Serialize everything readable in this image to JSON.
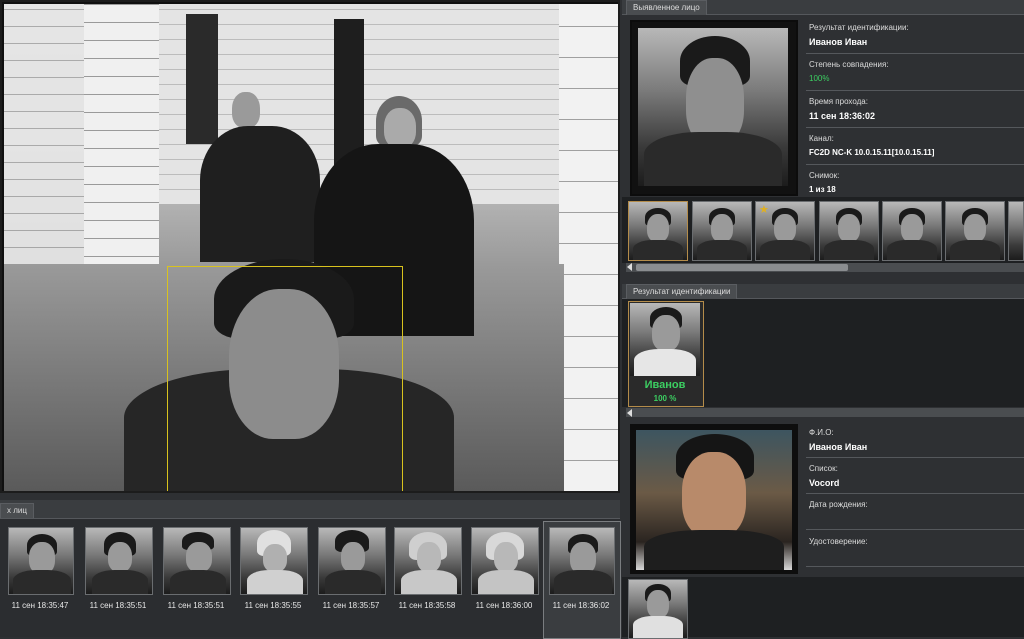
{
  "camera": {
    "name": "camera-view"
  },
  "detected": {
    "tab": "Выявленное лицо",
    "fields": [
      {
        "label": "Результат идентификации:",
        "value": "Иванов Иван"
      },
      {
        "label": "Степень совпадения:",
        "value": "100%"
      },
      {
        "label": "Время прохода:",
        "value": "11 сен 18:36:02"
      },
      {
        "label": "Канал:",
        "value": "FC2D NC-K 10.0.15.11[10.0.15.11]"
      },
      {
        "label": "Снимок:",
        "value": "1 из 18"
      }
    ]
  },
  "identification": {
    "tab": "Результат идентификации",
    "name": "Иванов",
    "percent": "100 %"
  },
  "person": {
    "fields": [
      {
        "label": "Ф.И.О:",
        "value": "Иванов Иван"
      },
      {
        "label": "Список:",
        "value": "Vocord"
      },
      {
        "label": "Дата рождения:",
        "value": ""
      },
      {
        "label": "Удостоверение:",
        "value": ""
      }
    ]
  },
  "faces": {
    "tab": "х лиц",
    "timestamps": [
      "11 сен 18:35:47",
      "11 сен 18:35:51",
      "11 сен 18:35:51",
      "11 сен 18:35:55",
      "11 сен 18:35:57",
      "11 сен 18:35:58",
      "11 сен 18:36:00",
      "11 сен 18:36:02"
    ]
  },
  "colors": {
    "accent": "#d8c21e",
    "match": "#3ccf62",
    "panel": "#2e3033"
  }
}
